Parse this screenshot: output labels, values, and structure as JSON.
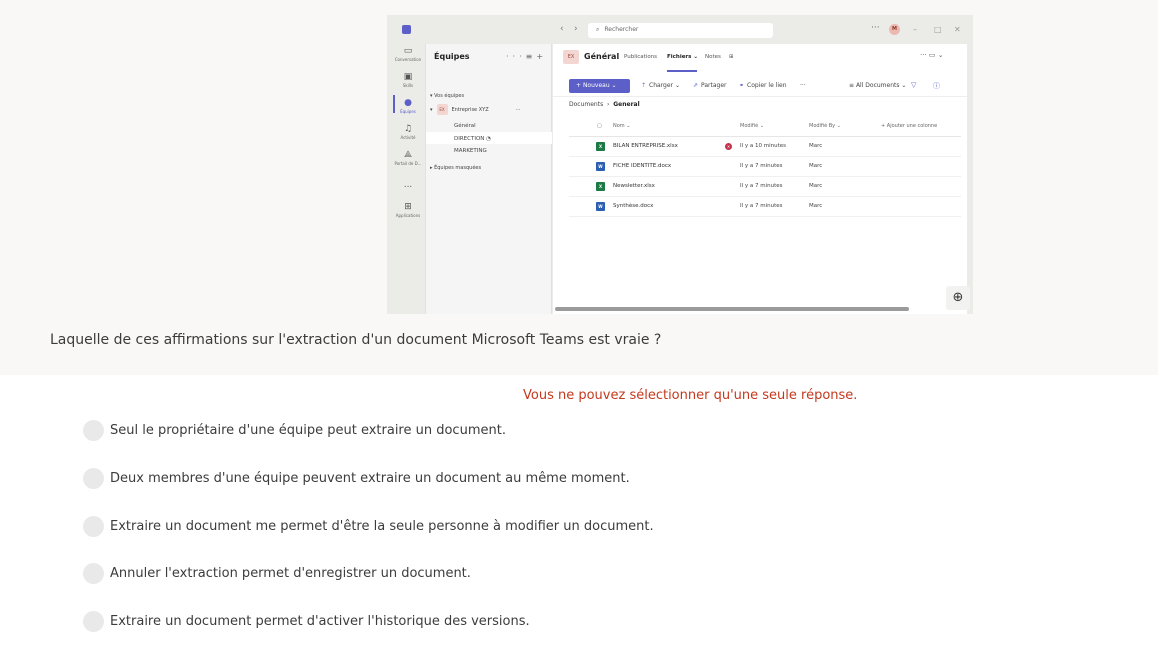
{
  "question": "Laquelle de ces affirmations sur l'extraction d'un document Microsoft Teams est vraie ?",
  "hint": "Vous ne pouvez sélectionner qu'une seule réponse.",
  "options": [
    "Seul le propriétaire d'une équipe peut extraire un document.",
    "Deux membres d'une équipe peuvent extraire un document au même moment.",
    "Extraire un document me permet d'être la seule personne à modifier un document.",
    "Annuler l'extraction permet d'enregistrer un document.",
    "Extraire un document permet d'activer l'historique des versions."
  ],
  "screenshot": {
    "search_placeholder": "Rechercher",
    "avatar": "M",
    "rail": [
      {
        "label": "Conversation",
        "icon": "chat-icon"
      },
      {
        "label": "Skills",
        "icon": "skills-icon"
      },
      {
        "label": "Équipes",
        "icon": "teams-icon"
      },
      {
        "label": "Activité",
        "icon": "bell-icon"
      },
      {
        "label": "Portail de D...",
        "icon": "portal-icon"
      },
      {
        "label": "...",
        "icon": "more-icon"
      },
      {
        "label": "Applications",
        "icon": "apps-icon"
      }
    ],
    "teams": {
      "title": "Équipes",
      "your_teams": "▾ Vos équipes",
      "team_badge": "EX",
      "team_name": "Entreprise XYZ",
      "channels": [
        "Général",
        "DIRECTION",
        "MARKETING"
      ],
      "hidden": "▸ Équipes masquées"
    },
    "channel": {
      "badge": "EX",
      "title": "Général",
      "tabs": [
        "Publications",
        "Fichiers",
        "Notes"
      ],
      "active_tab": "Fichiers"
    },
    "toolbar": {
      "new": "Nouveau",
      "upload": "Charger",
      "share": "Partager",
      "copy_link": "Copier le lien",
      "more": "···",
      "view": "All Documents"
    },
    "breadcrumb": {
      "root": "Documents",
      "current": "General"
    },
    "columns": {
      "name": "Nom",
      "modified": "Modifié",
      "modified_by": "Modifié By",
      "add": "+ Ajouter une colonne"
    },
    "files": [
      {
        "name": "BILAN ENTREPRISE.xlsx",
        "type": "xlsx",
        "modified": "Il y a 10 minutes",
        "by": "Marc",
        "checked_out": true
      },
      {
        "name": "FICHE IDENTITE.docx",
        "type": "docx",
        "modified": "Il y a 7 minutes",
        "by": "Marc",
        "checked_out": false
      },
      {
        "name": "Newsletter.xlsx",
        "type": "xlsx",
        "modified": "Il y a 7 minutes",
        "by": "Marc",
        "checked_out": false
      },
      {
        "name": "Synthèse.docx",
        "type": "docx",
        "modified": "Il y a 7 minutes",
        "by": "Marc",
        "checked_out": false
      }
    ]
  },
  "colors": {
    "accent": "#5b5fc7",
    "hint": "#c4391d",
    "excel": "#1d7a45",
    "word": "#2b5fb3"
  }
}
